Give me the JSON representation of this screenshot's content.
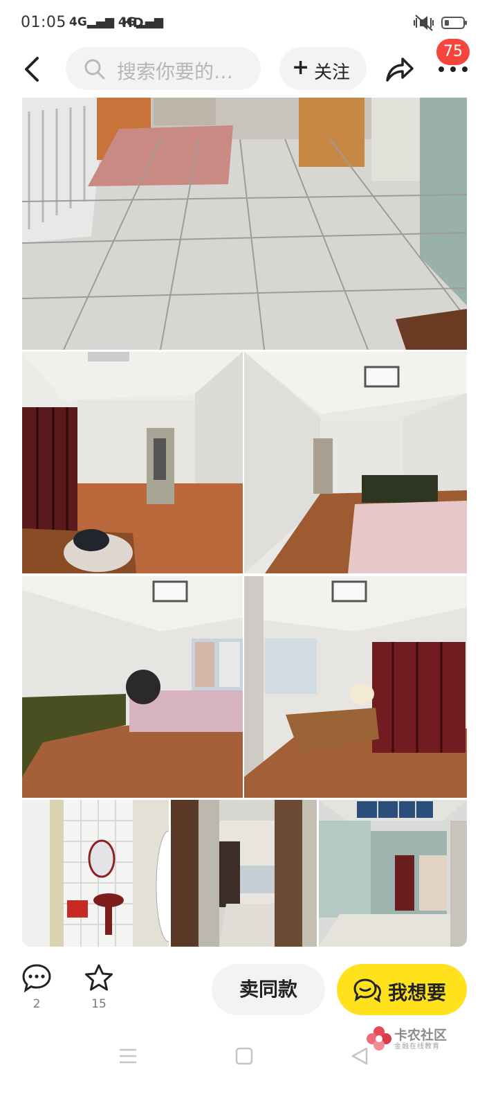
{
  "status_bar": {
    "time": "01:05",
    "network": "4G▂▄▆ 4G▂▄▆",
    "hd": "HD",
    "battery_level": 0.15
  },
  "top_nav": {
    "search_placeholder": "搜索你要的…",
    "follow_label": "关注",
    "follow_plus": "+",
    "notification_count": "75"
  },
  "icons": {
    "back": "chevron-left-icon",
    "search": "search-icon",
    "share": "share-arrow-icon",
    "more": "more-dots-icon",
    "comment": "comment-icon",
    "favorite": "star-icon",
    "chat": "chat-icon"
  },
  "photos": [
    {
      "name": "photo-living-floor"
    },
    {
      "name": "photo-bedroom-1"
    },
    {
      "name": "photo-bedroom-2"
    },
    {
      "name": "photo-bedroom-3"
    },
    {
      "name": "photo-bedroom-4"
    },
    {
      "name": "photo-bathroom"
    },
    {
      "name": "photo-balcony"
    },
    {
      "name": "photo-hallway"
    }
  ],
  "bottom_bar": {
    "comment_count": "2",
    "favorite_count": "15",
    "sell_same_label": "卖同款",
    "want_label": "我想要"
  },
  "watermark": {
    "title": "卡农社区",
    "subtitle": "金融在线教育"
  },
  "colors": {
    "accent_yellow": "#ffe11c",
    "badge_red": "#f5453c",
    "pill_gray": "#f3f3f3"
  }
}
